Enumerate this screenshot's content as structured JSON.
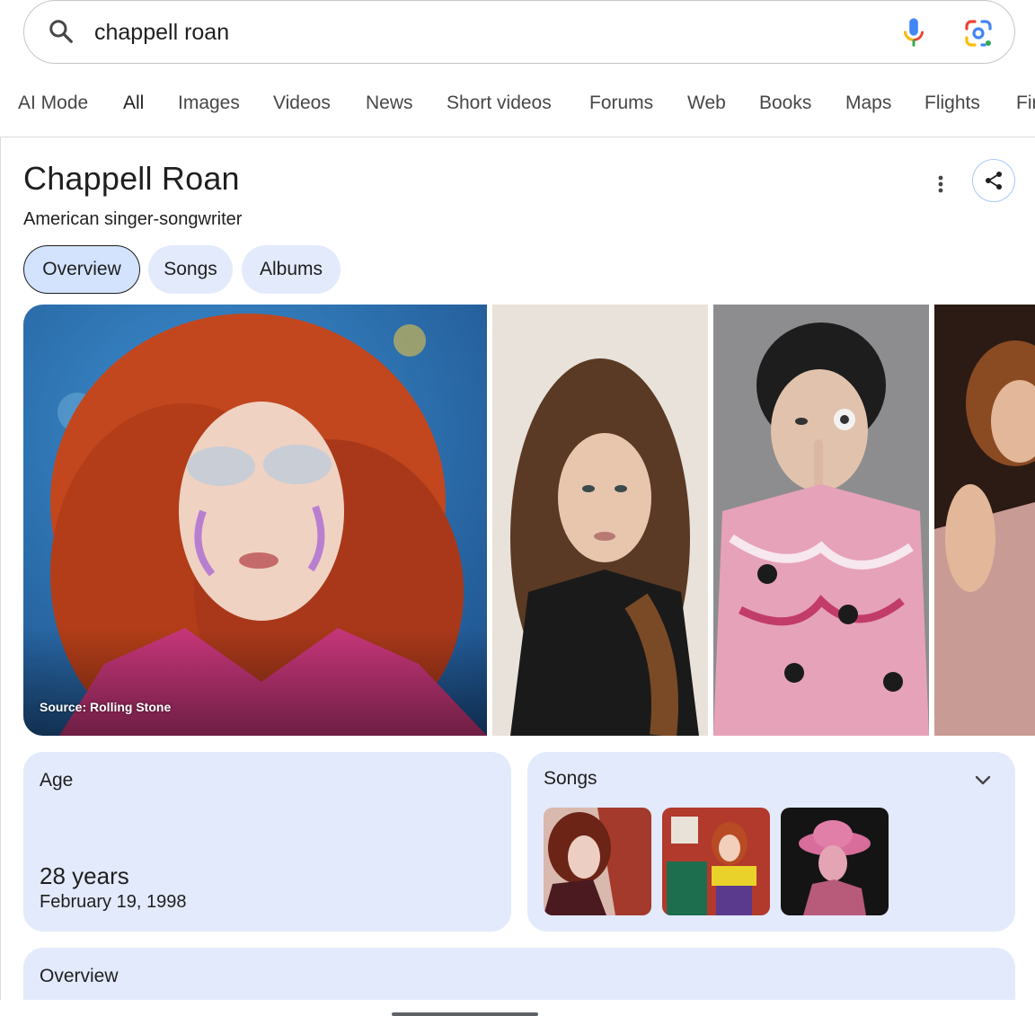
{
  "search": {
    "query": "chappell roan"
  },
  "tabs": [
    {
      "label": "AI Mode"
    },
    {
      "label": "All",
      "active": true
    },
    {
      "label": "Images"
    },
    {
      "label": "Videos"
    },
    {
      "label": "News"
    },
    {
      "label": "Short videos"
    },
    {
      "label": "Forums"
    },
    {
      "label": "Web"
    },
    {
      "label": "Books"
    },
    {
      "label": "Maps"
    },
    {
      "label": "Flights"
    },
    {
      "label": "Fir"
    }
  ],
  "panel": {
    "title": "Chappell Roan",
    "subtitle": "American singer-songwriter",
    "chips": [
      {
        "label": "Overview",
        "active": true
      },
      {
        "label": "Songs"
      },
      {
        "label": "Albums"
      }
    ],
    "image_caption": "Source: Rolling Stone"
  },
  "age_card": {
    "label": "Age",
    "value": "28 years",
    "date": "February 19, 1998"
  },
  "songs_card": {
    "label": "Songs"
  },
  "overview_card": {
    "label": "Overview"
  },
  "colors": {
    "card_bg": "#e3eafc",
    "chip_active_bg": "#d3e3fd",
    "text": "#1f1f1f",
    "google_blue": "#4285F4",
    "google_red": "#EA4335",
    "google_yellow": "#FBBC04",
    "google_green": "#34A853"
  }
}
